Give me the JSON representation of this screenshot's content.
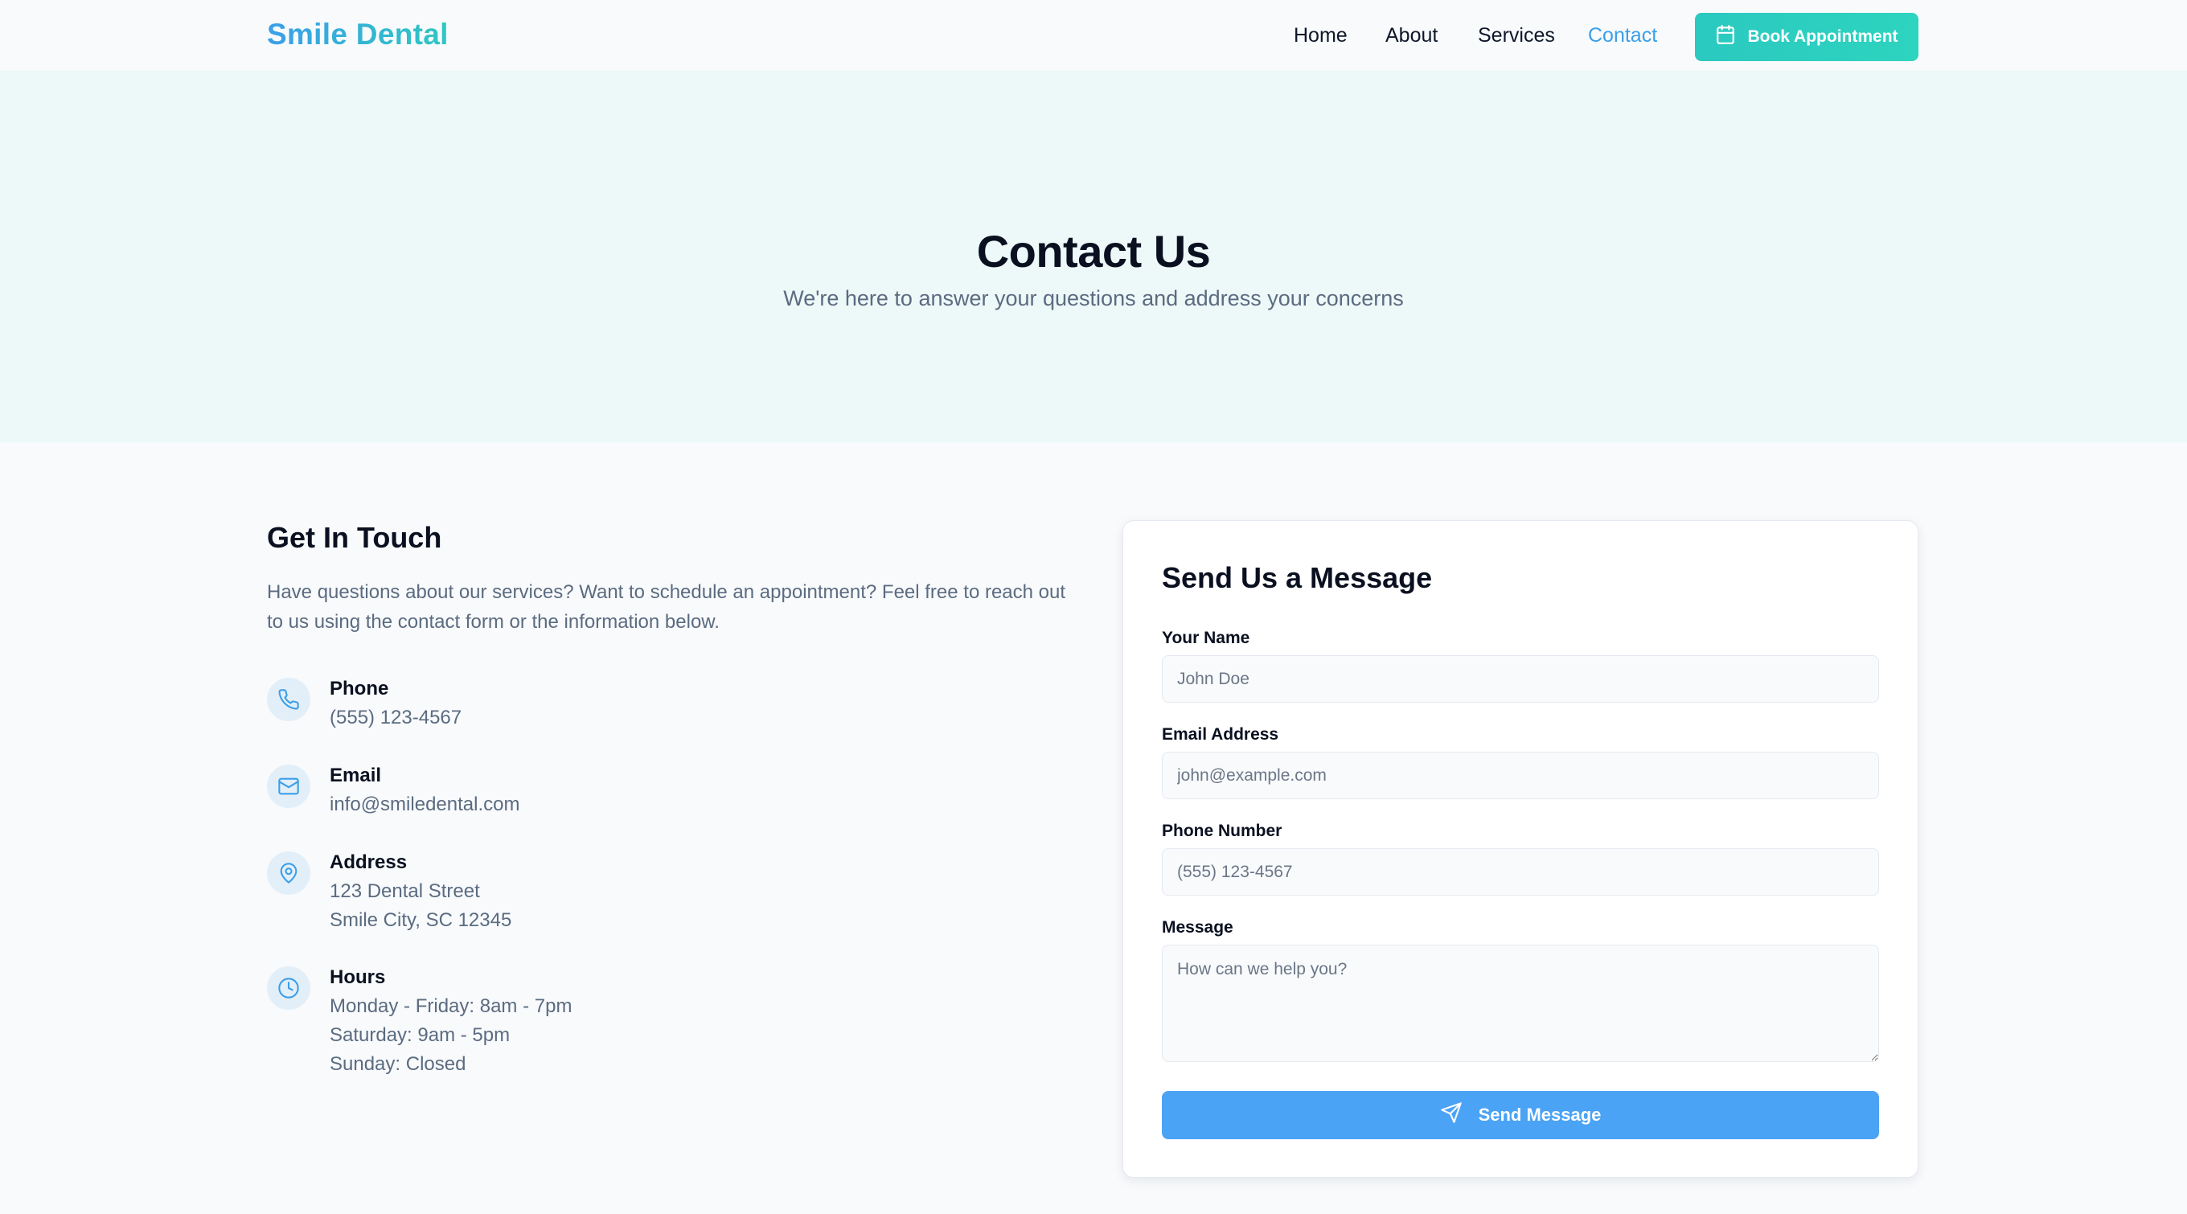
{
  "nav": {
    "logo": "Smile Dental",
    "links": [
      {
        "label": "Home"
      },
      {
        "label": "About"
      },
      {
        "label": "Services"
      },
      {
        "label": "Contact",
        "active": true
      }
    ],
    "cta": {
      "label": "Book Appointment",
      "icon": "calendar-icon"
    }
  },
  "hero": {
    "title": "Contact Us",
    "subtitle": "We're here to answer your questions and address your concerns"
  },
  "contact_info": {
    "title": "Get In Touch",
    "description": "Have questions about our services? Want to schedule an appointment? Feel free to reach out to us using the contact form or the information below.",
    "items": [
      {
        "icon": "phone-icon",
        "label": "Phone",
        "lines": [
          "(555) 123-4567"
        ]
      },
      {
        "icon": "mail-icon",
        "label": "Email",
        "lines": [
          "info@smiledental.com"
        ]
      },
      {
        "icon": "map-pin-icon",
        "label": "Address",
        "lines": [
          "123 Dental Street",
          "Smile City, SC 12345"
        ]
      },
      {
        "icon": "clock-icon",
        "label": "Hours",
        "lines": [
          "Monday - Friday: 8am - 7pm",
          "Saturday: 9am - 5pm",
          "Sunday: Closed"
        ]
      }
    ]
  },
  "form": {
    "title": "Send Us a Message",
    "name": {
      "label": "Your Name",
      "placeholder": "John Doe",
      "value": ""
    },
    "email": {
      "label": "Email Address",
      "placeholder": "john@example.com",
      "value": ""
    },
    "phone": {
      "label": "Phone Number",
      "placeholder": "(555) 123-4567",
      "value": ""
    },
    "message": {
      "label": "Message",
      "placeholder": "How can we help you?",
      "value": ""
    },
    "submit": {
      "label": "Send Message",
      "icon": "send-icon"
    }
  },
  "colors": {
    "brand_blue": "#3b9fe8",
    "brand_teal": "#2dd4bf",
    "hero_bg": "#edf8f8",
    "send_button": "#4ba3f5"
  }
}
